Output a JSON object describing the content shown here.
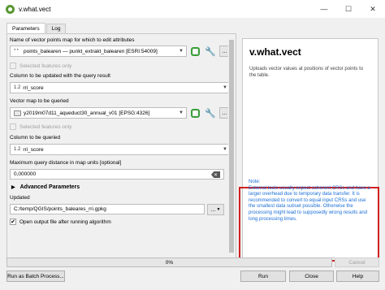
{
  "window": {
    "title": "v.what.vect",
    "minimize": "—",
    "maximize": "☐",
    "close": "✕"
  },
  "tabs": [
    {
      "label": "Parameters"
    },
    {
      "label": "Log"
    }
  ],
  "params": {
    "vector_label": "Name of vector points map for which to edit attributes",
    "vector_value": "points_balearen — punkt_extrakt_balearen [ESRI:54009]",
    "selected_only_1": "Selected features only",
    "column_label": "Column to be updated with the query result",
    "column_value": "rri_score",
    "queried_label": "Vector map to be queried",
    "queried_value": "y2019m07d11_aqueduct30_annual_v01 [EPSG:4326]",
    "selected_only_2": "Selected features only",
    "qcolumn_label": "Column to be queried",
    "qcolumn_value": "rri_score",
    "dmax_label": "Maximum query distance in map units [optional]",
    "dmax_value": "0,000000",
    "advanced_label": "Advanced Parameters",
    "updated_label": "Updated",
    "updated_value": "C:/temp/QGIS/points_baleares_rri.gpkg",
    "open_output_label": "Open output file after running algorithm",
    "field_icon_text": "1.2",
    "browse_text": "..."
  },
  "help": {
    "title": "v.what.vect",
    "description": "Uploads vector values at positions of vector points to the table.",
    "note": "Note:\nExternal tools usually expect coherent CRSs and have a larger overhead due to temporary data transfer. It is recommended to convert to equal input CRSs and use the smallest data subset possible. Otherwise the processing might lead to supposedly wrong results and long processing times."
  },
  "progress": {
    "value_text": "0%",
    "value": 0
  },
  "buttons": {
    "cancel": "Cancel",
    "batch": "Run as Batch Process...",
    "run": "Run",
    "close": "Close",
    "help": "Help"
  },
  "colors": {
    "note_border": "#d02020",
    "note_text": "#1a6fd8",
    "qgis_green": "#589632"
  },
  "icons": [
    "qgis-icon",
    "points-layer-icon",
    "raster-layer-icon",
    "field-icon",
    "iterate-icon",
    "wrench-icon",
    "clear-icon",
    "expand-triangle-icon",
    "checkmark-icon"
  ]
}
